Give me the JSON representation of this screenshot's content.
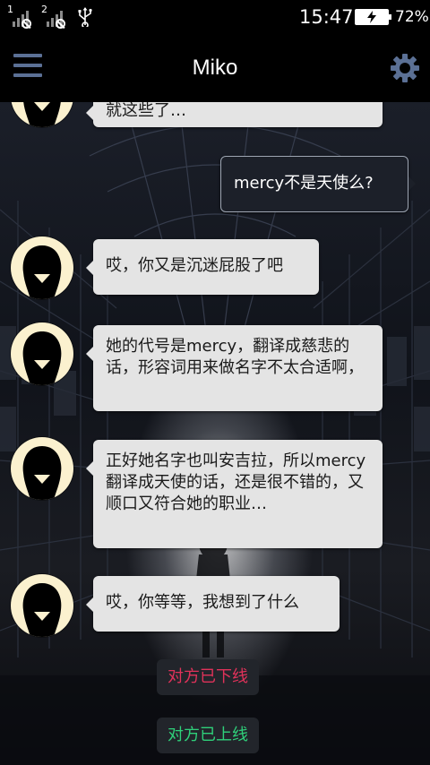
{
  "status_bar": {
    "sim1_label": "1",
    "sim2_label": "2",
    "time": "15:47",
    "battery_percent": "72%",
    "battery_level": 0.72
  },
  "header": {
    "title": "Miko",
    "menu_icon": "hamburger-menu-icon",
    "settings_icon": "gear-icon",
    "accent_color": "#5b7095"
  },
  "messages": [
    {
      "side": "incoming",
      "text": "就这些了…"
    },
    {
      "side": "outgoing",
      "text": "mercy不是天使么?"
    },
    {
      "side": "incoming",
      "text": "哎，你又是沉迷屁股了吧"
    },
    {
      "side": "incoming",
      "text": "她的代号是mercy，翻译成慈悲的话，形容词用来做名字不太合适啊，"
    },
    {
      "side": "incoming",
      "text": "正好她名字也叫安吉拉，所以mercy翻译成天使的话，还是很不错的，又顺口又符合她的职业…"
    },
    {
      "side": "incoming",
      "text": "哎，你等等，我想到了什么"
    }
  ],
  "system_notices": [
    {
      "text": "对方已下线",
      "color": "#e0325a"
    },
    {
      "text": "对方已上线",
      "color": "#2fd07a"
    }
  ]
}
